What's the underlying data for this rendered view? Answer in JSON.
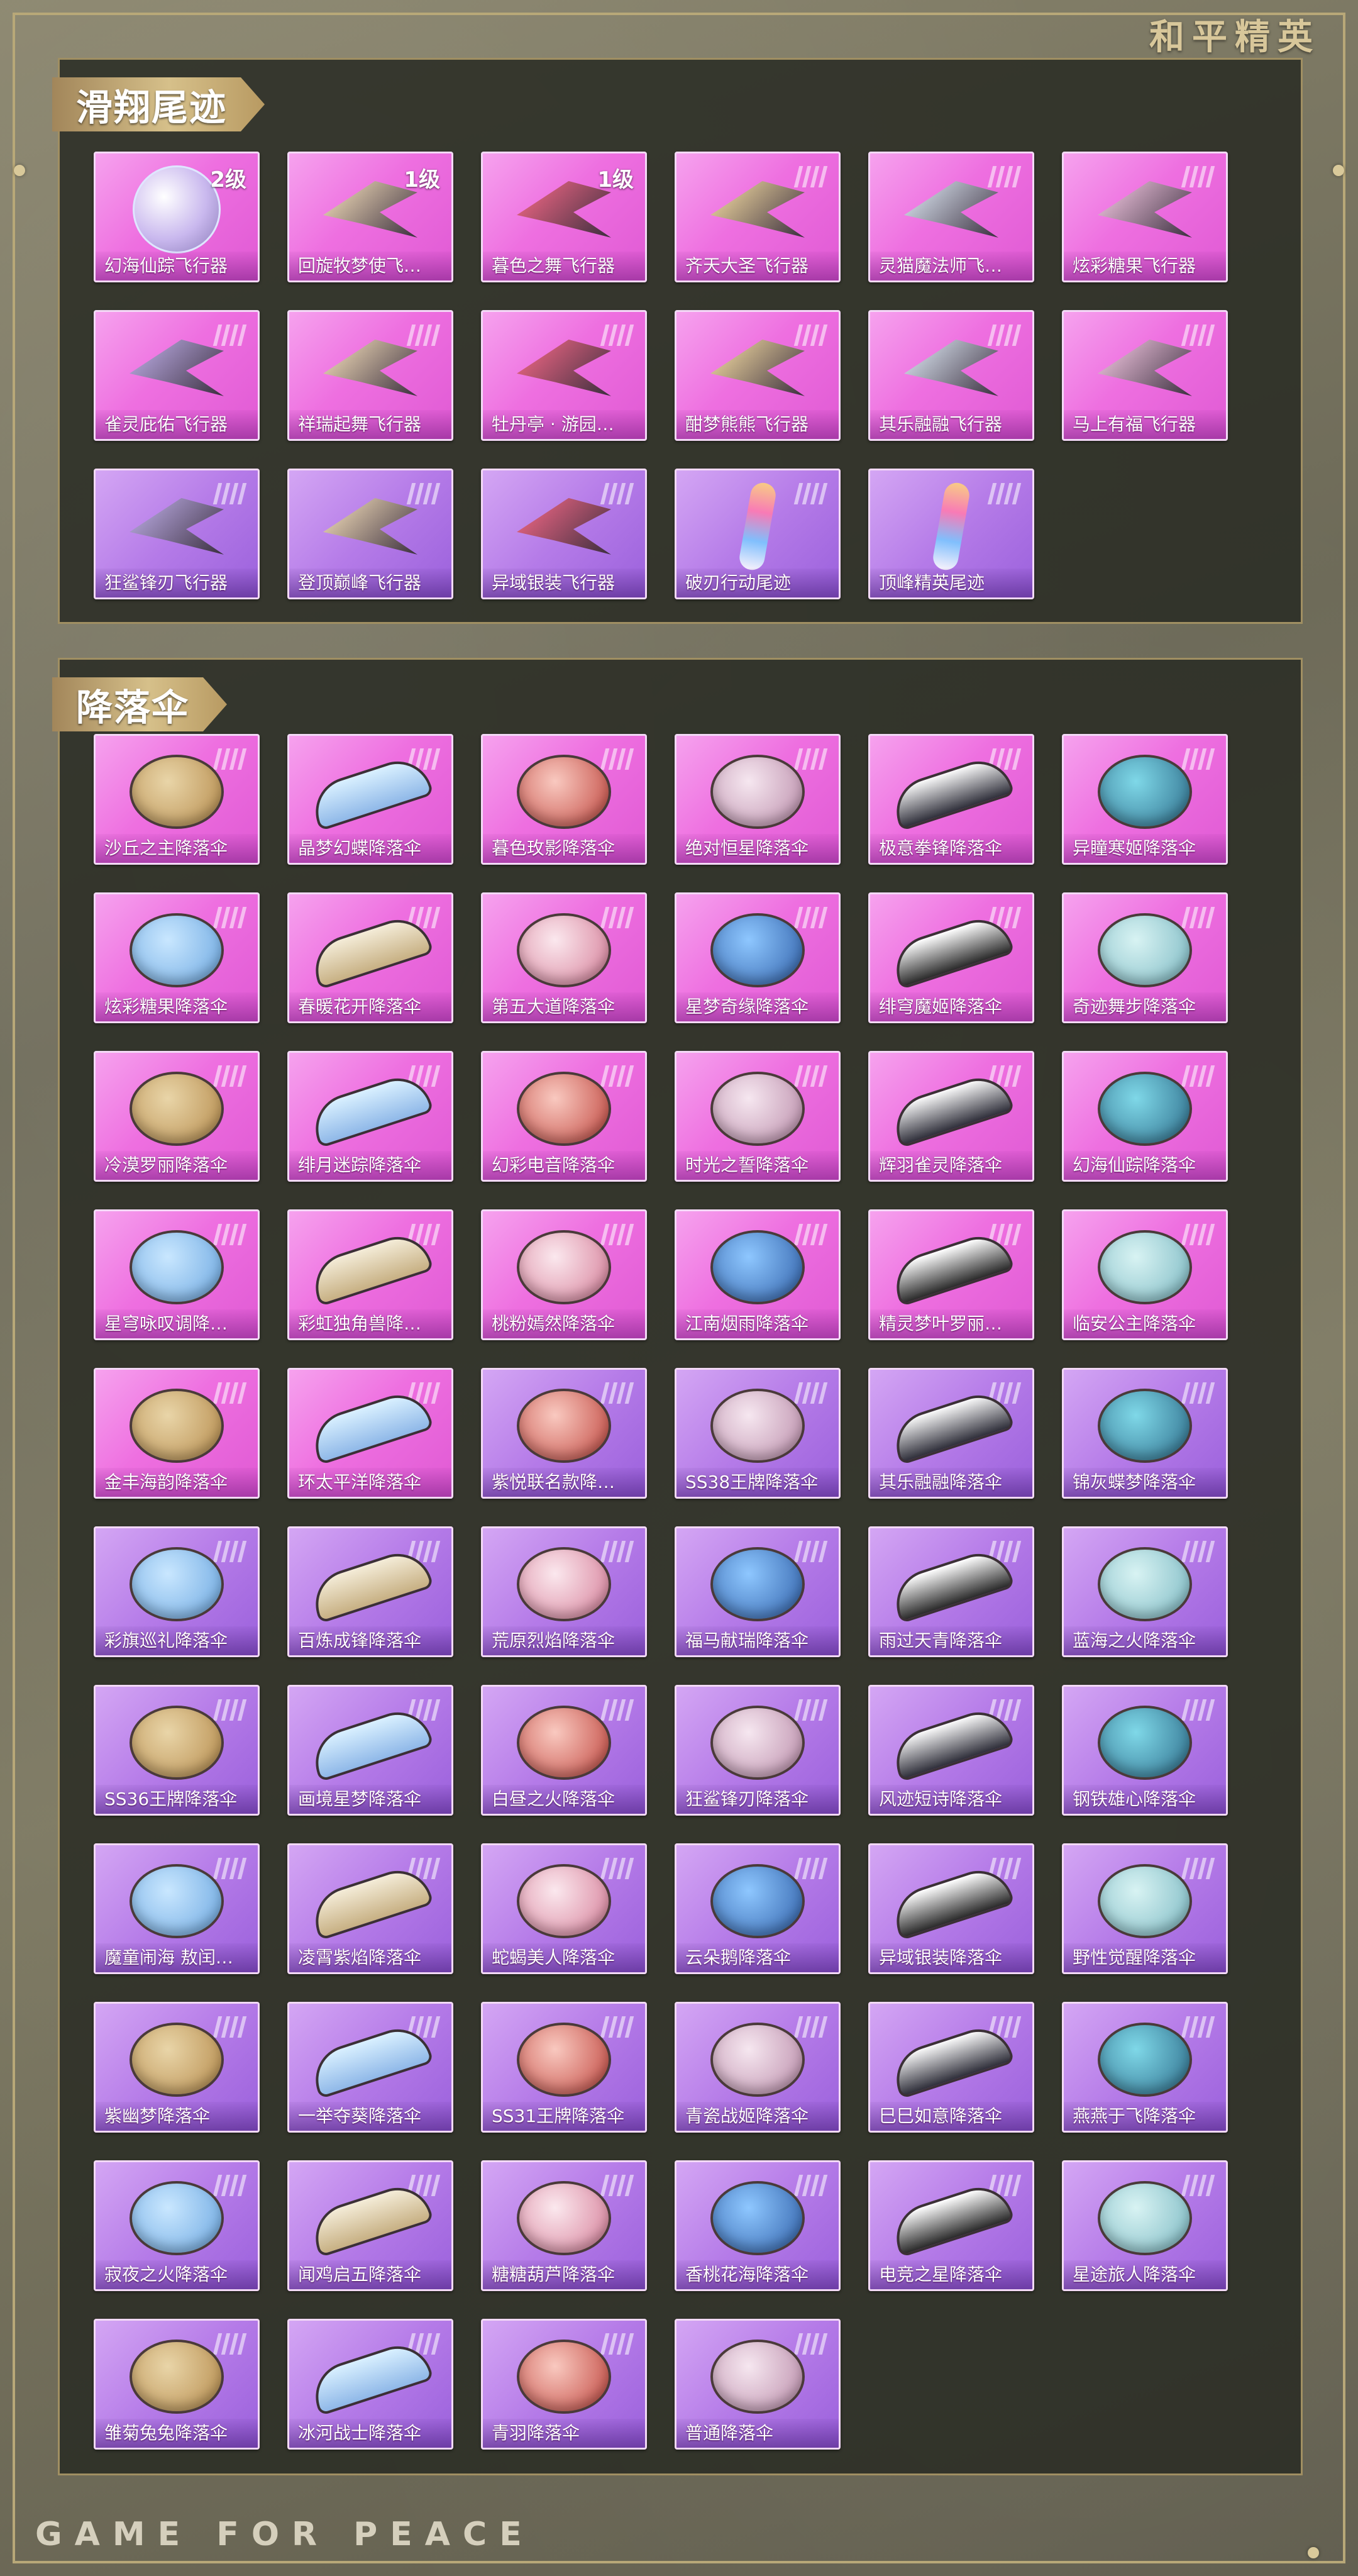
{
  "brand": "和平精英",
  "footer": "GAME FOR PEACE",
  "sections": {
    "gliders": {
      "title": "滑翔尾迹",
      "items": [
        {
          "label": "幻海仙踪飞行器",
          "level": "2级"
        },
        {
          "label": "回旋牧梦使飞…",
          "level": "1级"
        },
        {
          "label": "暮色之舞飞行器",
          "level": "1级"
        },
        {
          "label": "齐天大圣飞行器"
        },
        {
          "label": "灵猫魔法师飞…"
        },
        {
          "label": "炫彩糖果飞行器"
        },
        {
          "label": "雀灵庇佑飞行器"
        },
        {
          "label": "祥瑞起舞飞行器"
        },
        {
          "label": "牡丹亭 · 游园…"
        },
        {
          "label": "酣梦熊熊飞行器"
        },
        {
          "label": "其乐融融飞行器"
        },
        {
          "label": "马上有福飞行器"
        },
        {
          "label": "狂鲨锋刃飞行器"
        },
        {
          "label": "登顶巅峰飞行器"
        },
        {
          "label": "异域银装飞行器"
        },
        {
          "label": "破刃行动尾迹"
        },
        {
          "label": "顶峰精英尾迹"
        }
      ]
    },
    "parachutes": {
      "title": "降落伞",
      "items": [
        {
          "label": "沙丘之主降落伞"
        },
        {
          "label": "晶梦幻蝶降落伞"
        },
        {
          "label": "暮色玫影降落伞"
        },
        {
          "label": "绝对恒星降落伞"
        },
        {
          "label": "极意拳锋降落伞"
        },
        {
          "label": "异瞳寒姬降落伞"
        },
        {
          "label": "炫彩糖果降落伞"
        },
        {
          "label": "春暖花开降落伞"
        },
        {
          "label": "第五大道降落伞"
        },
        {
          "label": "星梦奇缘降落伞"
        },
        {
          "label": "绯穹魔姬降落伞"
        },
        {
          "label": "奇迹舞步降落伞"
        },
        {
          "label": "冷漠罗丽降落伞"
        },
        {
          "label": "绯月迷踪降落伞"
        },
        {
          "label": "幻彩电音降落伞"
        },
        {
          "label": "时光之誓降落伞"
        },
        {
          "label": "辉羽雀灵降落伞"
        },
        {
          "label": "幻海仙踪降落伞"
        },
        {
          "label": "星穹咏叹调降…"
        },
        {
          "label": "彩虹独角兽降…"
        },
        {
          "label": "桃粉嫣然降落伞"
        },
        {
          "label": "江南烟雨降落伞"
        },
        {
          "label": "精灵梦叶罗丽…"
        },
        {
          "label": "临安公主降落伞"
        },
        {
          "label": "金丰海韵降落伞"
        },
        {
          "label": "环太平洋降落伞"
        },
        {
          "label": "紫悦联名款降…"
        },
        {
          "label": "SS38王牌降落伞"
        },
        {
          "label": "其乐融融降落伞"
        },
        {
          "label": "锦灰蝶梦降落伞"
        },
        {
          "label": "彩旗巡礼降落伞"
        },
        {
          "label": "百炼成锋降落伞"
        },
        {
          "label": "荒原烈焰降落伞"
        },
        {
          "label": "福马献瑞降落伞"
        },
        {
          "label": "雨过天青降落伞"
        },
        {
          "label": "蓝海之火降落伞"
        },
        {
          "label": "SS36王牌降落伞"
        },
        {
          "label": "画境星梦降落伞"
        },
        {
          "label": "白昼之火降落伞"
        },
        {
          "label": "狂鲨锋刃降落伞"
        },
        {
          "label": "风迹短诗降落伞"
        },
        {
          "label": "钢铁雄心降落伞"
        },
        {
          "label": "魔童闹海 敖闰…"
        },
        {
          "label": "凌霄紫焰降落伞"
        },
        {
          "label": "蛇蝎美人降落伞"
        },
        {
          "label": "云朵鹅降落伞"
        },
        {
          "label": "异域银装降落伞"
        },
        {
          "label": "野性觉醒降落伞"
        },
        {
          "label": "紫幽梦降落伞"
        },
        {
          "label": "一举夺葵降落伞"
        },
        {
          "label": "SS31王牌降落伞"
        },
        {
          "label": "青瓷战姬降落伞"
        },
        {
          "label": "巳巳如意降落伞"
        },
        {
          "label": "燕燕于飞降落伞"
        },
        {
          "label": "寂夜之火降落伞"
        },
        {
          "label": "闻鸡启五降落伞"
        },
        {
          "label": "糖糖葫芦降落伞"
        },
        {
          "label": "香桃花海降落伞"
        },
        {
          "label": "电竞之星降落伞"
        },
        {
          "label": "星途旅人降落伞"
        },
        {
          "label": "雏菊兔兔降落伞"
        },
        {
          "label": "冰河战士降落伞"
        },
        {
          "label": "青羽降落伞"
        },
        {
          "label": "普通降落伞"
        }
      ]
    }
  },
  "colors": {
    "pink_card": "#ee6fe0",
    "purple_card": "#b57be8",
    "gold_title": "#d6c08a",
    "panel": "#2a2c24"
  }
}
